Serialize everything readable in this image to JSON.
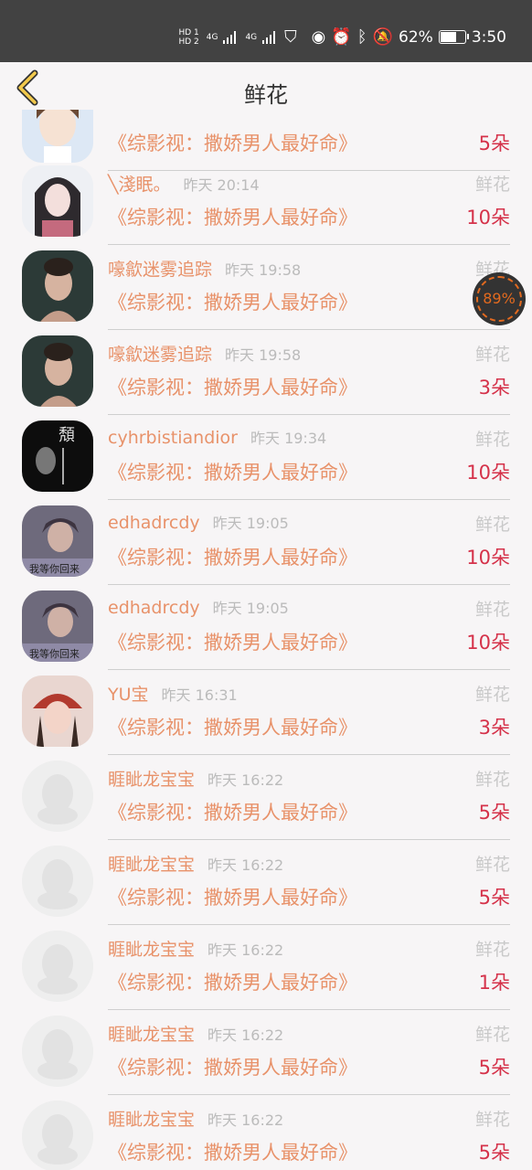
{
  "status_bar": {
    "net_top": "HD 1",
    "net_bottom": "HD 2",
    "signal1": "4G",
    "signal2": "4G",
    "battery_percent": "62%",
    "time": "3:50"
  },
  "header": {
    "title": "鲜花",
    "back_icon": "chevron-left-icon"
  },
  "floating_badge": {
    "value": "89%"
  },
  "items": [
    {
      "name": "",
      "time": "",
      "gift": "",
      "work": "《综影视：撒娇男人最好命》",
      "count": "5朵",
      "avatar": "cartoon-girl"
    },
    {
      "name": "╲淺眠。",
      "time": "昨天 20:14",
      "gift": "鲜花",
      "work": "《综影视：撒娇男人最好命》",
      "count": "10朵",
      "avatar": "anime-girl"
    },
    {
      "name": "嚎歙迷雾追踪",
      "time": "昨天 19:58",
      "gift": "鲜花",
      "work": "《综影视：撒娇男人最好命》",
      "count": "",
      "avatar": "woman-photo"
    },
    {
      "name": "嚎歙迷雾追踪",
      "time": "昨天 19:58",
      "gift": "鲜花",
      "work": "《综影视：撒娇男人最好命》",
      "count": "3朵",
      "avatar": "woman-photo"
    },
    {
      "name": "cyhrbistiandior",
      "time": "昨天 19:34",
      "gift": "鲜花",
      "work": "《综影视：撒娇男人最好命》",
      "count": "10朵",
      "avatar": "dark-photo"
    },
    {
      "name": "edhadrcdy",
      "time": "昨天 19:05",
      "gift": "鲜花",
      "work": "《综影视：撒娇男人最好命》",
      "count": "10朵",
      "avatar": "girl-photo"
    },
    {
      "name": "edhadrcdy",
      "time": "昨天 19:05",
      "gift": "鲜花",
      "work": "《综影视：撒娇男人最好命》",
      "count": "10朵",
      "avatar": "girl-photo"
    },
    {
      "name": "YU宝",
      "time": "昨天 16:31",
      "gift": "鲜花",
      "work": "《综影视：撒娇男人最好命》",
      "count": "3朵",
      "avatar": "red-hat-girl"
    },
    {
      "name": "睚眦龙宝宝",
      "time": "昨天 16:22",
      "gift": "鲜花",
      "work": "《综影视：撒娇男人最好命》",
      "count": "5朵",
      "avatar": "default"
    },
    {
      "name": "睚眦龙宝宝",
      "time": "昨天 16:22",
      "gift": "鲜花",
      "work": "《综影视：撒娇男人最好命》",
      "count": "5朵",
      "avatar": "default"
    },
    {
      "name": "睚眦龙宝宝",
      "time": "昨天 16:22",
      "gift": "鲜花",
      "work": "《综影视：撒娇男人最好命》",
      "count": "1朵",
      "avatar": "default"
    },
    {
      "name": "睚眦龙宝宝",
      "time": "昨天 16:22",
      "gift": "鲜花",
      "work": "《综影视：撒娇男人最好命》",
      "count": "5朵",
      "avatar": "default"
    },
    {
      "name": "睚眦龙宝宝",
      "time": "昨天 16:22",
      "gift": "鲜花",
      "work": "《综影视：撒娇男人最好命》",
      "count": "5朵",
      "avatar": "default"
    }
  ],
  "colors": {
    "accent": "#e8926a",
    "count": "#d5324a",
    "statusbar": "#424242"
  }
}
